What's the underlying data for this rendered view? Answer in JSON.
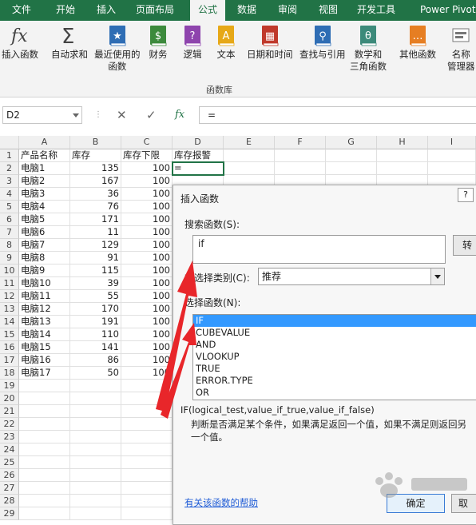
{
  "menu_tabs": [
    "文件",
    "开始",
    "插入",
    "页面布局",
    "公式",
    "数据",
    "审阅",
    "视图",
    "开发工具",
    "Power Pivot"
  ],
  "active_tab": "公式",
  "ribbon": {
    "buttons": [
      {
        "label": "插入函数",
        "label2": "",
        "icon": "fx-icon",
        "color": "#444444"
      },
      {
        "label": "自动求和",
        "label2": "",
        "icon": "sigma-icon",
        "color": "#444444"
      },
      {
        "label": "最近使用的",
        "label2": "函数",
        "icon": "star-book-icon",
        "color": "#2e6db4"
      },
      {
        "label": "财务",
        "label2": "",
        "icon": "finance-book-icon",
        "color": "#3c8a3c"
      },
      {
        "label": "逻辑",
        "label2": "",
        "icon": "question-book-icon",
        "color": "#8e44ad"
      },
      {
        "label": "文本",
        "label2": "",
        "icon": "text-book-icon",
        "color": "#e6a817"
      },
      {
        "label": "日期和时间",
        "label2": "",
        "icon": "calendar-book-icon",
        "color": "#c0392b"
      },
      {
        "label": "查找与引用",
        "label2": "",
        "icon": "search-book-icon",
        "color": "#2e6db4"
      },
      {
        "label": "数学和",
        "label2": "三角函数",
        "icon": "theta-book-icon",
        "color": "#3c8a7a"
      },
      {
        "label": "其他函数",
        "label2": "",
        "icon": "more-book-icon",
        "color": "#e67e22"
      },
      {
        "label": "名称",
        "label2": "管理器",
        "icon": "name-manager-icon",
        "color": "#777777"
      }
    ],
    "group_label": "函数库"
  },
  "formula_bar": {
    "name_box": "D2",
    "formula": "="
  },
  "sheet": {
    "columns": [
      "A",
      "B",
      "C",
      "D",
      "E",
      "F",
      "G",
      "H",
      "I"
    ],
    "headers": [
      "产品名称",
      "库存",
      "库存下限",
      "库存报警"
    ],
    "rows": [
      [
        "电脑1",
        "135",
        "100",
        "="
      ],
      [
        "电脑2",
        "167",
        "100",
        ""
      ],
      [
        "电脑3",
        "36",
        "100",
        ""
      ],
      [
        "电脑4",
        "76",
        "100",
        ""
      ],
      [
        "电脑5",
        "171",
        "100",
        ""
      ],
      [
        "电脑6",
        "11",
        "100",
        ""
      ],
      [
        "电脑7",
        "129",
        "100",
        ""
      ],
      [
        "电脑8",
        "91",
        "100",
        ""
      ],
      [
        "电脑9",
        "115",
        "100",
        ""
      ],
      [
        "电脑10",
        "39",
        "100",
        ""
      ],
      [
        "电脑11",
        "55",
        "100",
        ""
      ],
      [
        "电脑12",
        "170",
        "100",
        ""
      ],
      [
        "电脑13",
        "191",
        "100",
        ""
      ],
      [
        "电脑14",
        "110",
        "100",
        ""
      ],
      [
        "电脑15",
        "141",
        "100",
        ""
      ],
      [
        "电脑16",
        "86",
        "100",
        ""
      ],
      [
        "电脑17",
        "50",
        "100",
        ""
      ]
    ],
    "row_numbers": [
      "1",
      "2",
      "3",
      "4",
      "5",
      "6",
      "7",
      "8",
      "9",
      "10",
      "11",
      "12",
      "13",
      "14",
      "15",
      "16",
      "17",
      "18",
      "19",
      "20",
      "21",
      "22",
      "23",
      "24",
      "25",
      "26",
      "27",
      "28",
      "29"
    ]
  },
  "dialog": {
    "title": "插入函数",
    "help": "?",
    "search_label": "搜索函数(S):",
    "search_value": "if",
    "goto_label": "转",
    "category_label": "或选择类别(C):",
    "category_value": "推荐",
    "select_label": "选择函数(N):",
    "functions": [
      "IF",
      "CUBEVALUE",
      "AND",
      "VLOOKUP",
      "TRUE",
      "ERROR.TYPE",
      "OR"
    ],
    "selected_function": "IF",
    "signature": "IF(logical_test,value_if_true,value_if_false)",
    "description": "判断是否满足某个条件，如果满足返回一个值，如果不满足则返回另一个值。",
    "help_link": "有关该函数的帮助",
    "ok_label": "确定",
    "cancel_label": "取"
  },
  "colors": {
    "excel_green": "#217346",
    "arrow_red": "#e8262a",
    "selection_blue": "#3399ff"
  }
}
